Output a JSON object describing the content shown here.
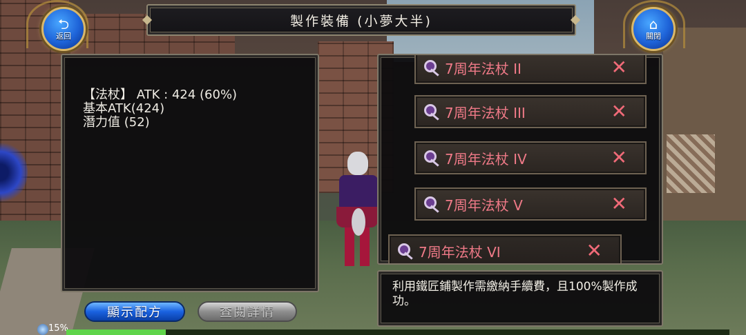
{
  "window": {
    "title": "製作裝備 (小夢大半)"
  },
  "nav": {
    "back_label": "返回",
    "back_icon": "return-arrow-icon",
    "close_label": "關閉",
    "close_icon": "home-icon"
  },
  "item_stats": {
    "line1": "【法杖】 ATK : 424 (60%)",
    "line2": "基本ATK(424)",
    "line3": "潛力值 (52)"
  },
  "recipes": [
    {
      "name": "7周年法杖 II",
      "selected": false
    },
    {
      "name": "7周年法杖 III",
      "selected": false
    },
    {
      "name": "7周年法杖 IV",
      "selected": false
    },
    {
      "name": "7周年法杖 V",
      "selected": false
    },
    {
      "name": "7周年法杖 VI",
      "selected": true
    }
  ],
  "remove_glyph": "✕",
  "description": "利用鐵匠鋪製作需繳納手續費，且100%製作成功。",
  "buttons": {
    "show_recipe": "顯示配方",
    "view_details": "查閱詳情"
  },
  "progress": {
    "label": "15%",
    "value": 0.15
  },
  "colors": {
    "recipe_text": "#f07a88",
    "accent_blue": "#1e63d8",
    "frame_gold": "#d9b86a"
  }
}
